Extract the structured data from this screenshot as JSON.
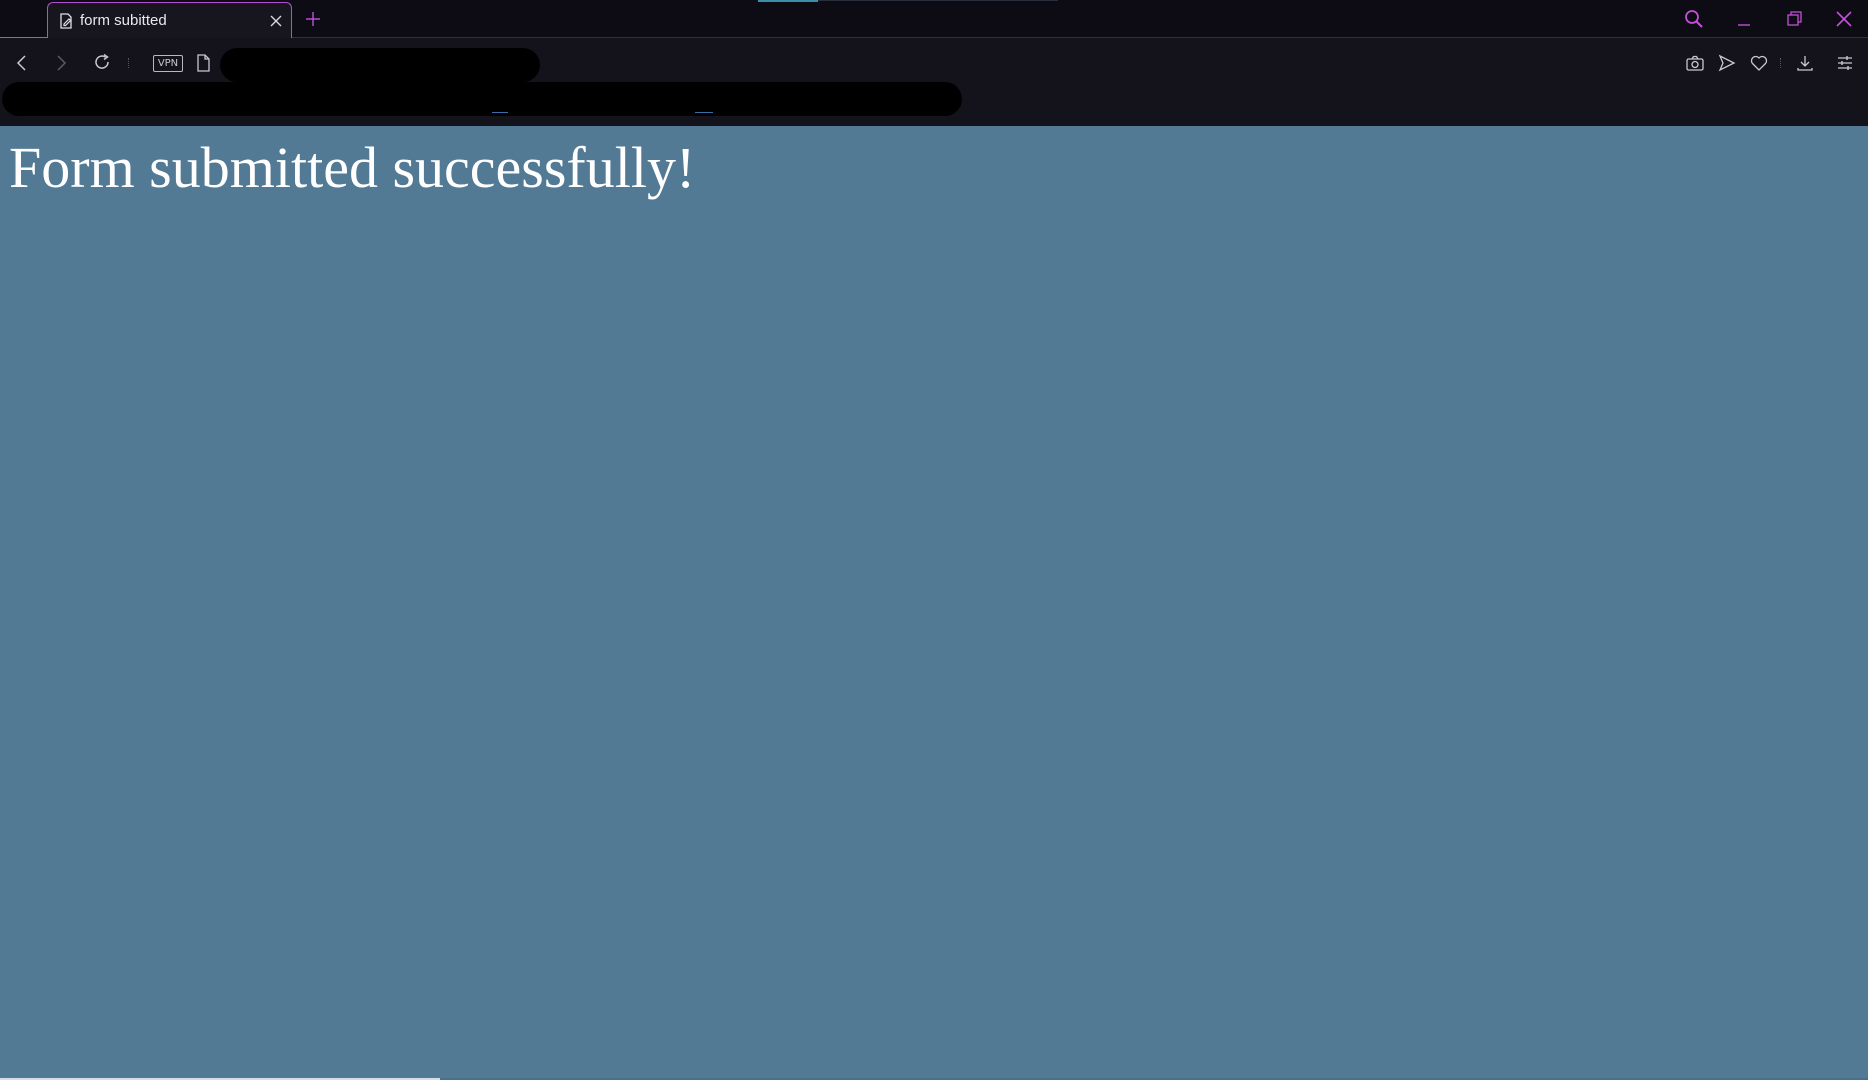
{
  "tab": {
    "title": "form subitted",
    "icon": "edit-document-icon"
  },
  "toolbar": {
    "vpn_label": "VPN"
  },
  "page": {
    "heading": "Form submitted successfully!"
  },
  "colors": {
    "page_background": "#527a95",
    "chrome_background": "#14131b",
    "accent": "#b24fd0"
  }
}
